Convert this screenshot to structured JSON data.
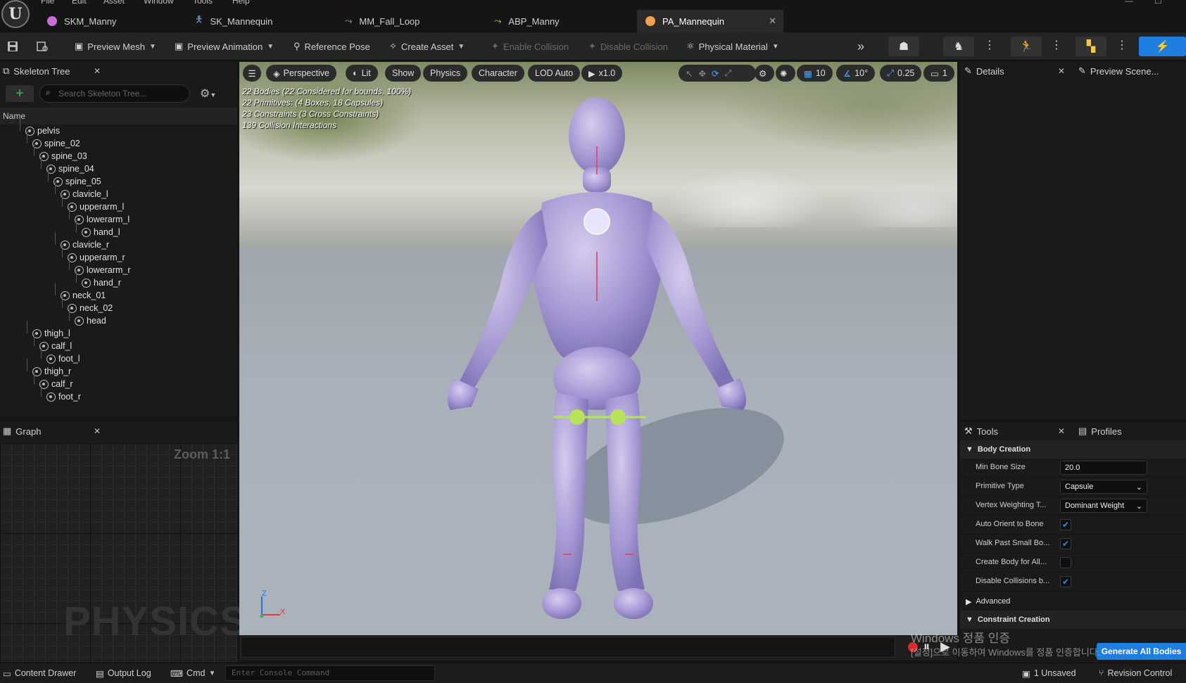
{
  "menu": [
    "File",
    "Edit",
    "Asset",
    "Window",
    "Tools",
    "Help"
  ],
  "doc_tabs": [
    {
      "label": "SKM_Manny",
      "color": "#c86fd6"
    },
    {
      "label": "SK_Mannequin",
      "color": "#6fa8dc"
    },
    {
      "label": "MM_Fall_Loop",
      "color": "#6fcf97"
    },
    {
      "label": "ABP_Manny",
      "color": "#f2c94c"
    },
    {
      "label": "PA_Mannequin",
      "color": "#f2a04c",
      "close": "✕"
    }
  ],
  "toolbar": {
    "preview_mesh": "Preview Mesh",
    "preview_animation": "Preview Animation",
    "reference_pose": "Reference Pose",
    "create_asset": "Create Asset",
    "enable_collision": "Enable Collision",
    "disable_collision": "Disable Collision",
    "physical_material": "Physical Material"
  },
  "skeleton_tree": {
    "title": "Skeleton Tree",
    "search_placeholder": "Search Skeleton Tree...",
    "column_name": "Name",
    "bones": [
      {
        "name": "pelvis",
        "depth": 0
      },
      {
        "name": "spine_02",
        "depth": 1
      },
      {
        "name": "spine_03",
        "depth": 2
      },
      {
        "name": "spine_04",
        "depth": 3
      },
      {
        "name": "spine_05",
        "depth": 4
      },
      {
        "name": "clavicle_l",
        "depth": 5
      },
      {
        "name": "upperarm_l",
        "depth": 6
      },
      {
        "name": "lowerarm_l",
        "depth": 7
      },
      {
        "name": "hand_l",
        "depth": 8
      },
      {
        "name": "clavicle_r",
        "depth": 5
      },
      {
        "name": "upperarm_r",
        "depth": 6
      },
      {
        "name": "lowerarm_r",
        "depth": 7
      },
      {
        "name": "hand_r",
        "depth": 8
      },
      {
        "name": "neck_01",
        "depth": 5
      },
      {
        "name": "neck_02",
        "depth": 6
      },
      {
        "name": "head",
        "depth": 7
      },
      {
        "name": "thigh_l",
        "depth": 1
      },
      {
        "name": "calf_l",
        "depth": 2
      },
      {
        "name": "foot_l",
        "depth": 3
      },
      {
        "name": "thigh_r",
        "depth": 1
      },
      {
        "name": "calf_r",
        "depth": 2
      },
      {
        "name": "foot_r",
        "depth": 3
      }
    ]
  },
  "graph": {
    "title": "Graph",
    "zoom": "Zoom 1:1",
    "watermark": "PHYSICS"
  },
  "viewport": {
    "perspective": "Perspective",
    "lit": "Lit",
    "show": "Show",
    "physics": "Physics",
    "character": "Character",
    "lod": "LOD Auto",
    "speed": "x1.0",
    "grid_snap": "10",
    "rot_snap": "10°",
    "scale_snap": "0.25",
    "camera_speed": "1",
    "stats": [
      "22 Bodies (22 Considered for bounds, 100%)",
      "22 Primitives: (4 Boxes, 18 Capsules)",
      "23 Constraints (3 Cross Constraints)",
      "139 Collision Interactions"
    ],
    "axis_z": "Z",
    "axis_x": "X"
  },
  "details": {
    "title": "Details",
    "preview_scene": "Preview Scene..."
  },
  "tools": {
    "title": "Tools",
    "profiles": "Profiles",
    "body_creation": "Body Creation",
    "rows": [
      {
        "label": "Min Bone Size",
        "value": "20.0",
        "type": "text"
      },
      {
        "label": "Primitive Type",
        "value": "Capsule",
        "type": "select"
      },
      {
        "label": "Vertex Weighting T...",
        "value": "Dominant Weight",
        "type": "select"
      },
      {
        "label": "Auto Orient to Bone",
        "checked": true,
        "type": "check"
      },
      {
        "label": "Walk Past Small Bo...",
        "checked": true,
        "type": "check"
      },
      {
        "label": "Create Body for All...",
        "checked": false,
        "type": "check"
      },
      {
        "label": "Disable Collisions b...",
        "checked": true,
        "type": "check"
      }
    ],
    "advanced": "Advanced",
    "constraint_creation": "Constraint Creation",
    "generate_button": "Generate All Bodies"
  },
  "watermark_lines": [
    "Windows 정품 인증",
    "[설정]으로 이동하여 Windows를 정품 인증합니다."
  ],
  "statusbar": {
    "content_drawer": "Content Drawer",
    "output_log": "Output Log",
    "cmd": "Cmd",
    "console_placeholder": "Enter Console Command",
    "unsaved": "1 Unsaved",
    "revision_control": "Revision Control"
  },
  "colors": {
    "accent": "#1e7fe0",
    "body_purple": "#a99ad8",
    "constraint_green": "#b6e35a"
  }
}
